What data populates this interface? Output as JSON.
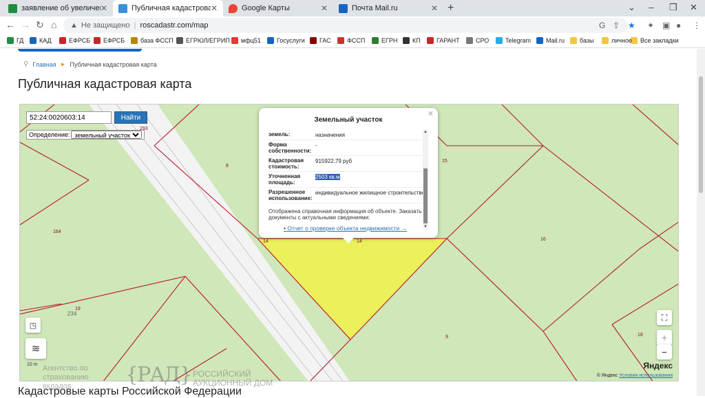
{
  "browser": {
    "tabs": [
      {
        "title": "заявление об увеличении иска",
        "active": false,
        "favicon": "drive-icon",
        "color": "#1e8e3e"
      },
      {
        "title": "Публичная кадастровая карта",
        "active": true,
        "favicon": "rosreestr-icon",
        "color": "#3a8fd8"
      },
      {
        "title": "Google Карты",
        "active": false,
        "favicon": "google-maps-icon",
        "color": "#ea4335"
      },
      {
        "title": "Почта Mail.ru",
        "active": false,
        "favicon": "mail-icon",
        "color": "#1565c0"
      }
    ],
    "address": {
      "security_label": "Не защищено",
      "url": "roscadastr.com/map"
    },
    "bookmarks": [
      {
        "label": "ГД",
        "color": "#1e8e3e"
      },
      {
        "label": "КАД",
        "color": "#1565c0"
      },
      {
        "label": "ЕФРСБ",
        "color": "#c62828"
      },
      {
        "label": "ЕФРСБ",
        "color": "#c62828"
      },
      {
        "label": "база ФССП",
        "color": "#b8860b"
      },
      {
        "label": "ЕГРЮЛ/ЕГРИП",
        "color": "#555555"
      },
      {
        "label": "мфц51",
        "color": "#e53935"
      },
      {
        "label": "Госуслуги",
        "color": "#1565c0"
      },
      {
        "label": "ГАС",
        "color": "#8b0000"
      },
      {
        "label": "ФССП",
        "color": "#d32f2f"
      },
      {
        "label": "ЕГРН",
        "color": "#2e7d32"
      },
      {
        "label": "КП",
        "color": "#333333"
      },
      {
        "label": "ГАРАНТ",
        "color": "#c62828"
      },
      {
        "label": "СРО",
        "color": "#777777"
      },
      {
        "label": "Telegram",
        "color": "#29a9eb"
      },
      {
        "label": "Mail.ru",
        "color": "#1565c0"
      },
      {
        "label": "базы",
        "color": "#f4c542"
      },
      {
        "label": "личное",
        "color": "#f4c542"
      }
    ],
    "all_bookmarks": "Все закладки"
  },
  "page": {
    "breadcrumb": {
      "home": "Главная",
      "current": "Публичная кадастровая карта"
    },
    "title": "Публичная кадастровая карта",
    "bottom_title": "Кадастровые карты Российской Федерации"
  },
  "map": {
    "search_value": "52:24:0020603:14",
    "search_button": "Найти",
    "definition_label": "Определение:",
    "definition_value": "земельный участок",
    "parcel_labels": [
      "293",
      "8",
      "15",
      "164",
      "14",
      "14",
      "16",
      "19",
      "234",
      "9",
      "18"
    ],
    "scale": "10 m",
    "logo": "Яндекс",
    "copyright": "© Яндекс",
    "terms": "Условия использования"
  },
  "popup": {
    "title": "Земельный участок",
    "rows": [
      {
        "key": "земель:",
        "value": "назначения"
      },
      {
        "key": "Форма собственности:",
        "value": "-"
      },
      {
        "key": "Кадастровая стоимость:",
        "value": "915922.79 руб"
      },
      {
        "key": "Уточненная площадь:",
        "value": "2503 кв.м",
        "highlight": true
      },
      {
        "key": "Разрешенное использование:",
        "value": "индивидуальное жилищное строительство"
      }
    ],
    "info": "Отображена справочная информация об объекте. Заказать документы с актуальными сведениями:",
    "link": "Отчет о проверке объекта недвижимости →"
  },
  "watermark": {
    "agency": "Агентство по страхованию вкладов",
    "auction": "РОССИЙСКИЙ АУКЦИОННЫЙ ДОМ",
    "logo": "РАД"
  }
}
